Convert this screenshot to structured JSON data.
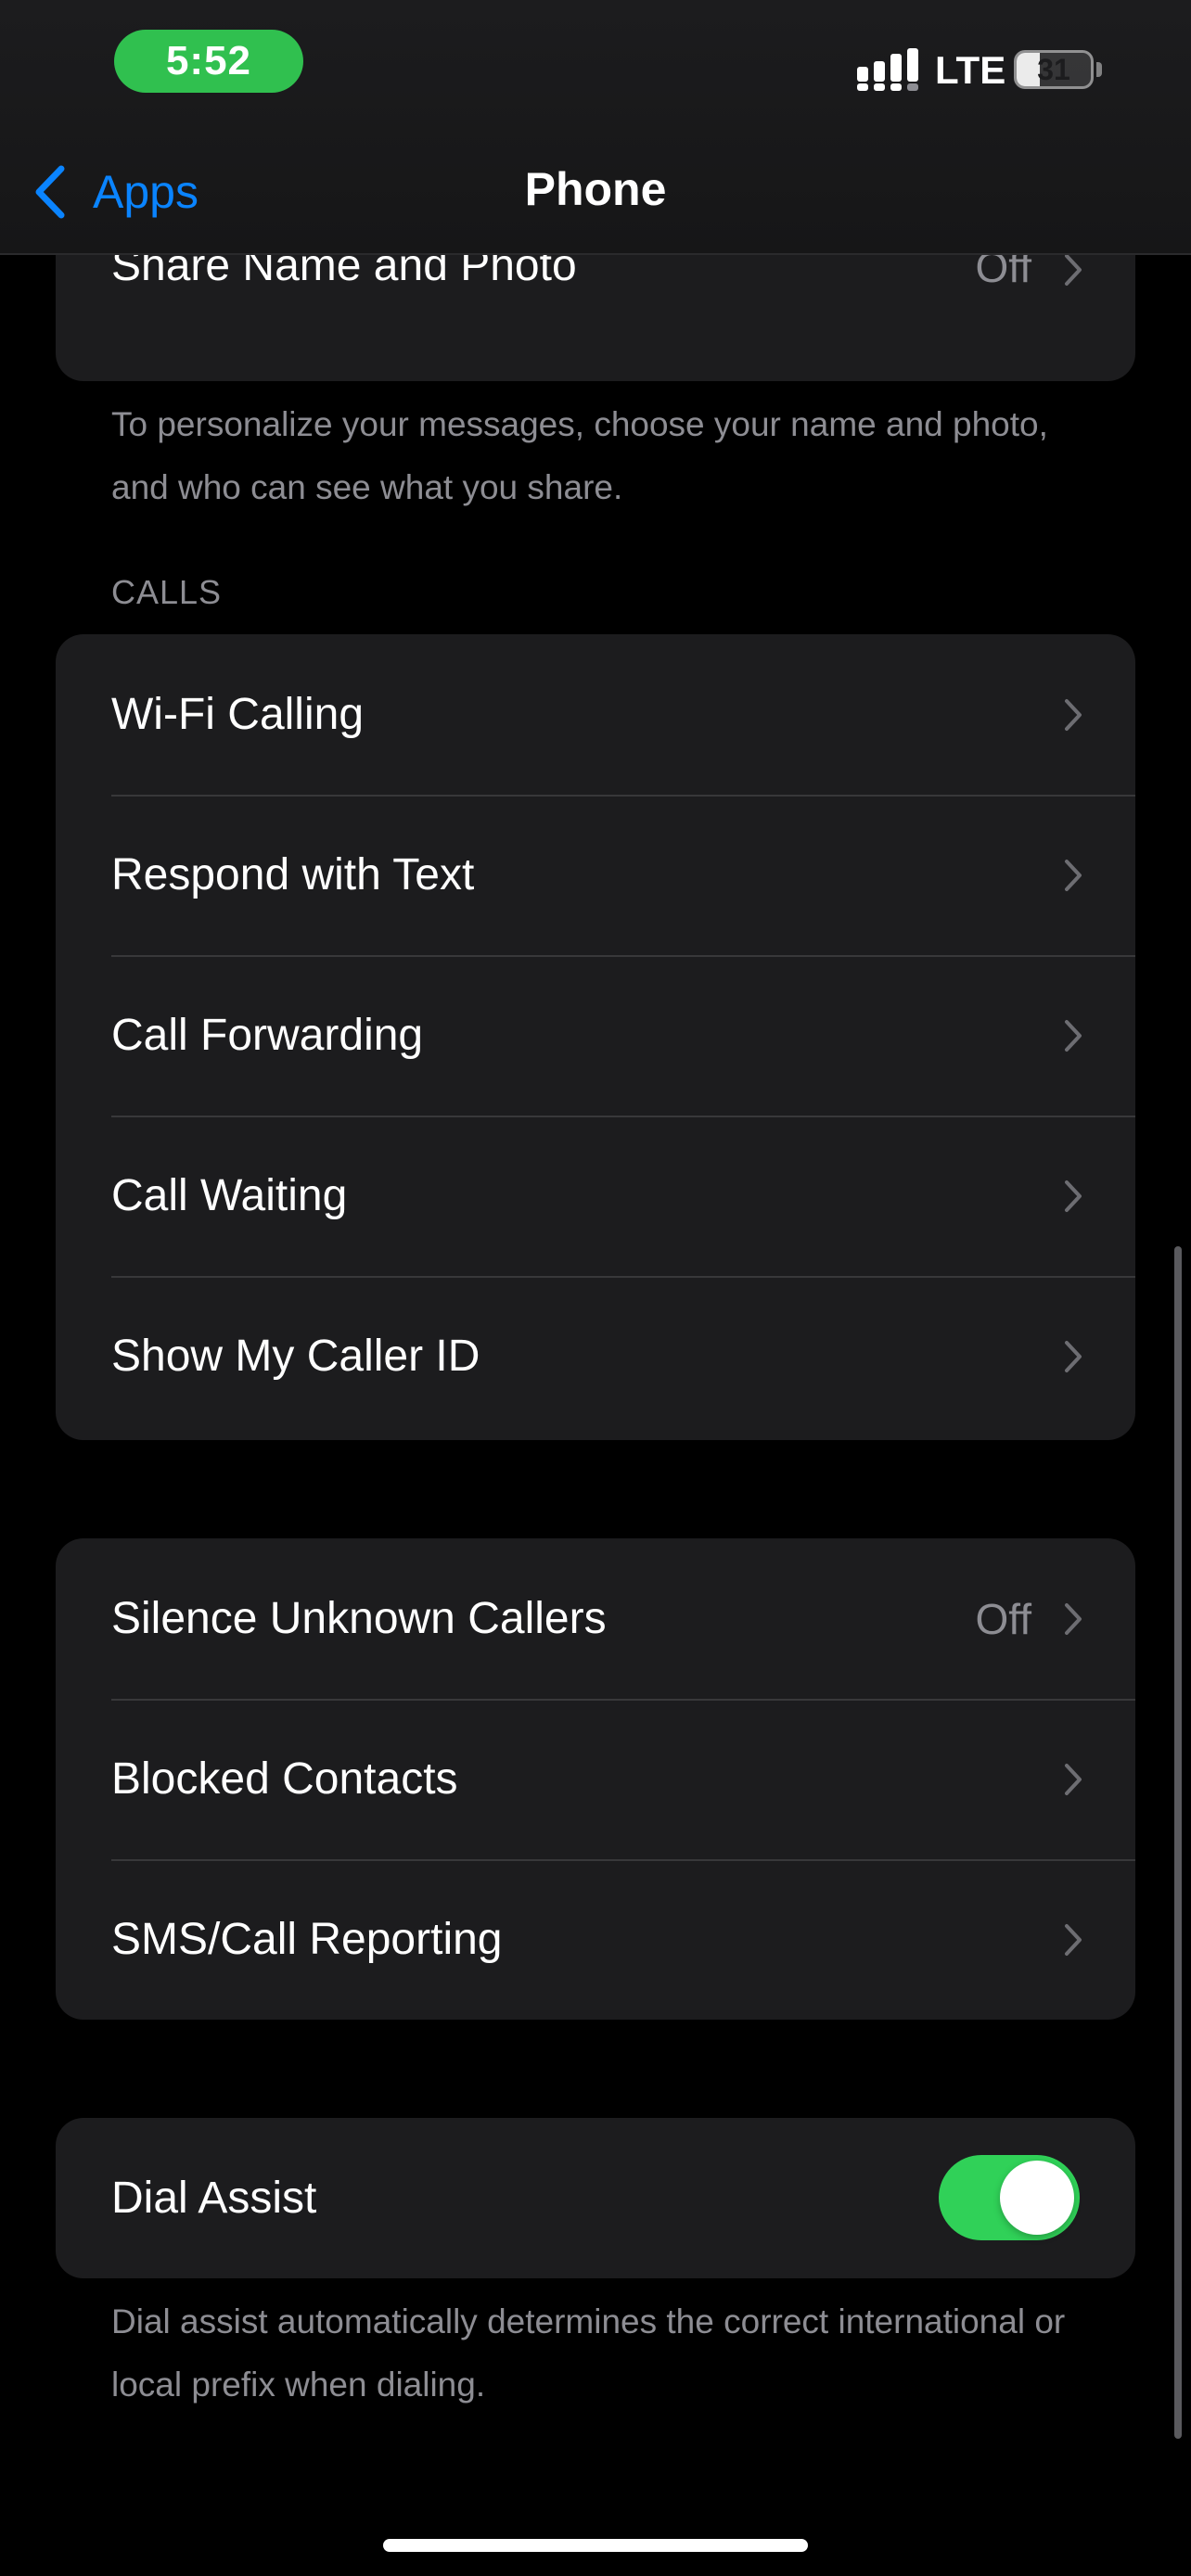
{
  "status_bar": {
    "time": "5:52",
    "network": "LTE",
    "battery_level": "31",
    "battery_fraction": 0.31,
    "time_pill_color": "#30c04f"
  },
  "nav": {
    "back_label": "Apps",
    "title": "Phone",
    "accent_color": "#0a84ff"
  },
  "share_section": {
    "row": {
      "label": "Share Name and Photo",
      "value": "Off"
    },
    "footer": "To personalize your messages, choose your name and photo, and who can see what you share."
  },
  "calls_section": {
    "header": "CALLS",
    "rows": [
      {
        "label": "Wi-Fi Calling"
      },
      {
        "label": "Respond with Text"
      },
      {
        "label": "Call Forwarding"
      },
      {
        "label": "Call Waiting"
      },
      {
        "label": "Show My Caller ID"
      }
    ]
  },
  "blocking_section": {
    "rows": [
      {
        "label": "Silence Unknown Callers",
        "value": "Off"
      },
      {
        "label": "Blocked Contacts"
      },
      {
        "label": "SMS/Call Reporting"
      }
    ]
  },
  "dial_assist_section": {
    "row": {
      "label": "Dial Assist",
      "toggle_on": true
    },
    "footer": "Dial assist automatically determines the correct international or local prefix when dialing.",
    "toggle_color": "#30d158"
  },
  "icons": {
    "back": "chevron-left-icon",
    "disclosure": "chevron-right-icon",
    "signal": "cellular-signal-icon",
    "battery": "battery-icon"
  }
}
